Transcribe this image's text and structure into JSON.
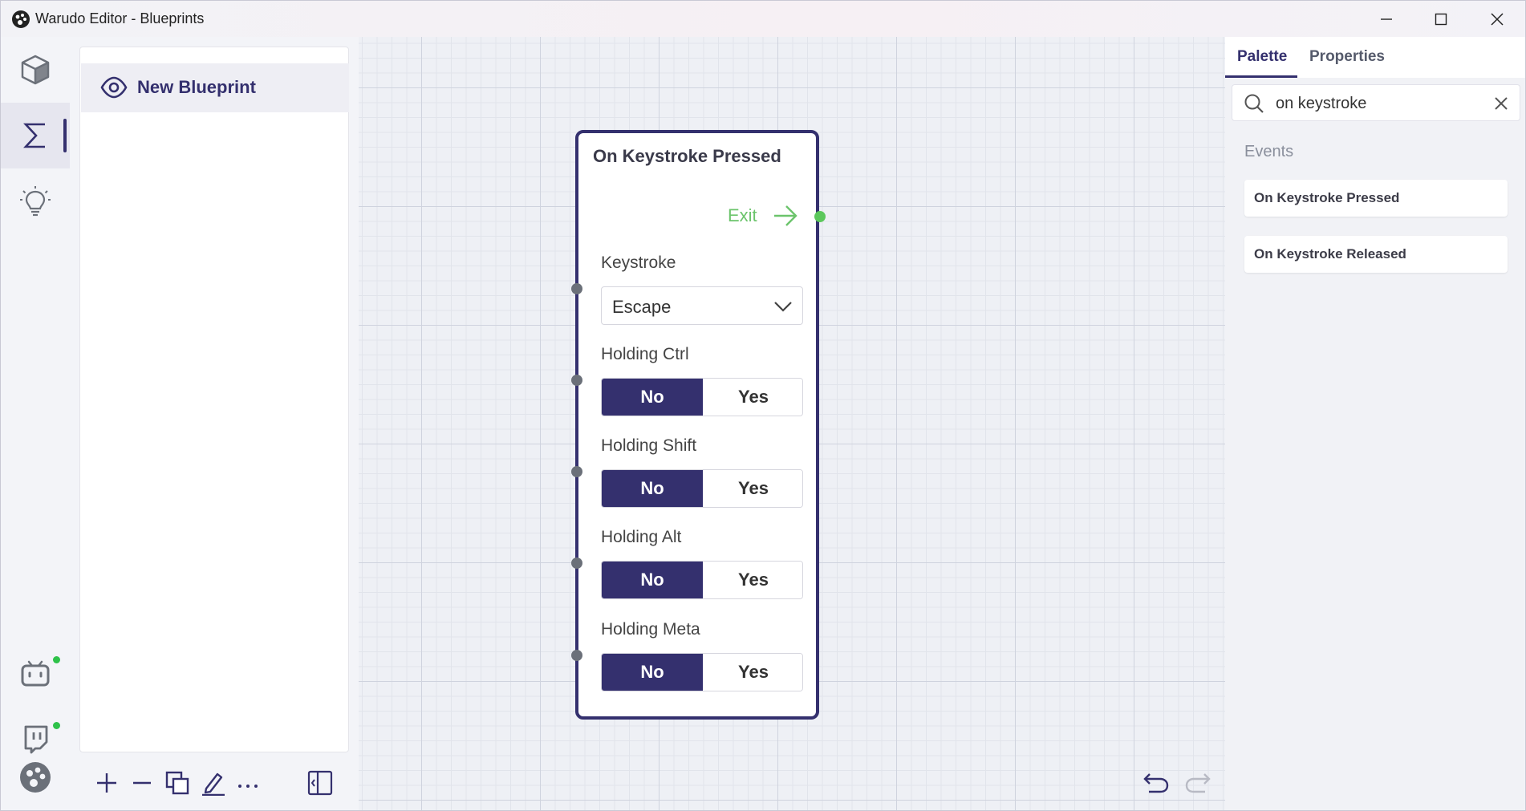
{
  "window": {
    "title": "Warudo Editor - Blueprints"
  },
  "sidebar": {
    "items": [
      {
        "icon": "cube-icon"
      },
      {
        "icon": "sigma-icon",
        "active": true
      },
      {
        "icon": "lightbulb-icon"
      },
      {
        "icon": "bilibili-icon",
        "status": "online"
      },
      {
        "icon": "twitch-icon",
        "status": "online"
      },
      {
        "icon": "warudo-logo-icon"
      }
    ]
  },
  "blueprints": {
    "items": [
      {
        "label": "New Blueprint",
        "visible": true
      }
    ]
  },
  "node": {
    "title": "On Keystroke Pressed",
    "exit_label": "Exit",
    "keystroke": {
      "label": "Keystroke",
      "value": "Escape"
    },
    "toggles": [
      {
        "label": "Holding Ctrl",
        "no": "No",
        "yes": "Yes",
        "selected": "No"
      },
      {
        "label": "Holding Shift",
        "no": "No",
        "yes": "Yes",
        "selected": "No"
      },
      {
        "label": "Holding Alt",
        "no": "No",
        "yes": "Yes",
        "selected": "No"
      },
      {
        "label": "Holding Meta",
        "no": "No",
        "yes": "Yes",
        "selected": "No"
      }
    ]
  },
  "right_panel": {
    "tabs": [
      {
        "label": "Palette",
        "active": true
      },
      {
        "label": "Properties",
        "active": false
      }
    ],
    "search": {
      "value": "on keystroke"
    },
    "section_title": "Events",
    "results": [
      {
        "label": "On Keystroke Pressed"
      },
      {
        "label": "On Keystroke Released"
      }
    ]
  },
  "colors": {
    "accent": "#34306e",
    "exit": "#6cc46c",
    "online": "#2ec24a"
  }
}
